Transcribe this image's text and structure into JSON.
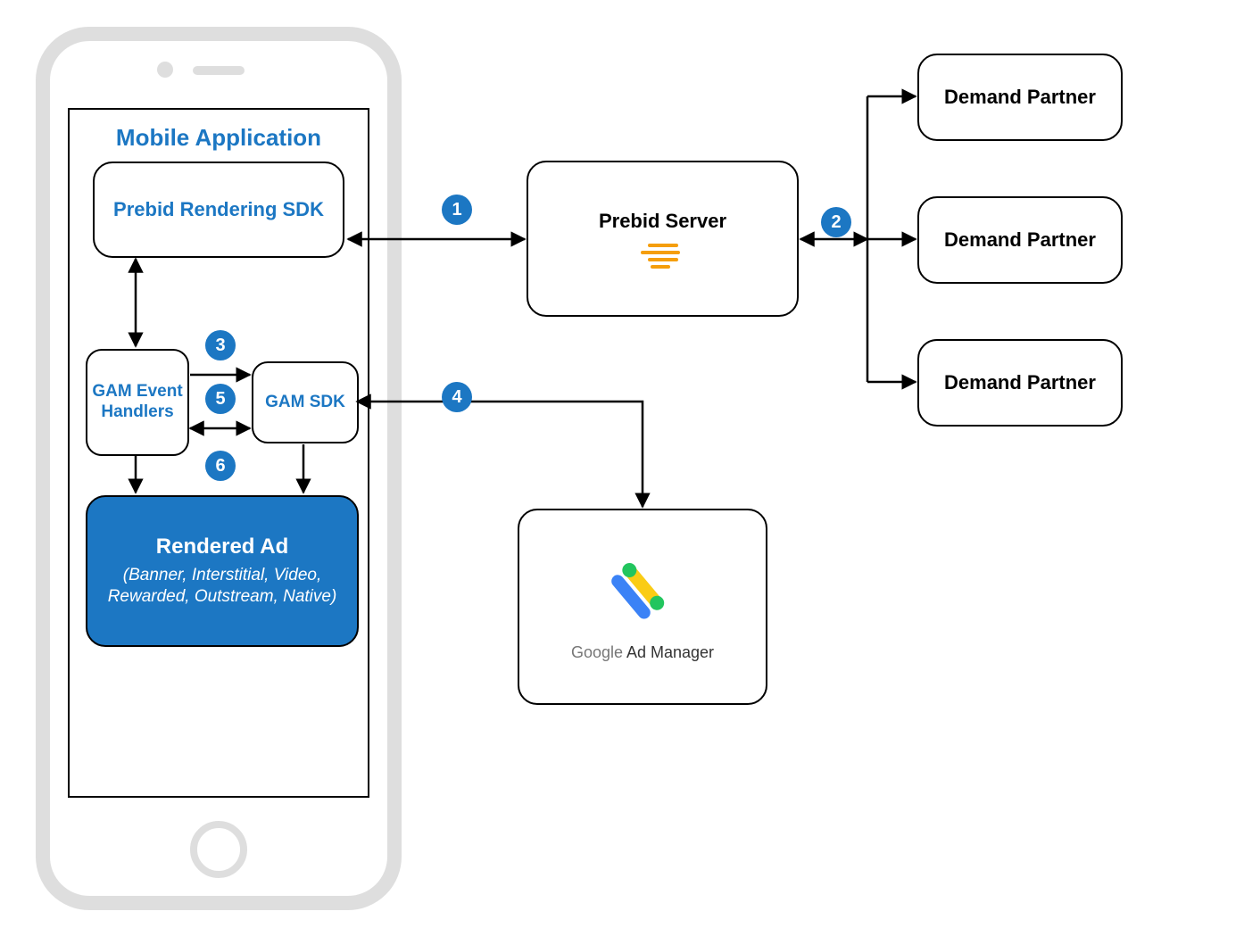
{
  "mobile": {
    "title": "Mobile Application",
    "prebid_sdk": "Prebid Rendering SDK",
    "gam_event_handlers": "GAM Event Handlers",
    "gam_sdk": "GAM SDK",
    "rendered_ad_title": "Rendered Ad",
    "rendered_ad_sub": "(Banner, Interstitial, Video, Rewarded, Outstream, Native)"
  },
  "server": {
    "label": "Prebid Server"
  },
  "demand_partners": {
    "label1": "Demand Partner",
    "label2": "Demand Partner",
    "label3": "Demand Partner"
  },
  "gam": {
    "label_google": "Google",
    "label_rest": " Ad Manager"
  },
  "steps": {
    "s1": "1",
    "s2": "2",
    "s3": "3",
    "s4": "4",
    "s5": "5",
    "s6": "6"
  }
}
